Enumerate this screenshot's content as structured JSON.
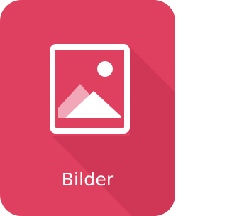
{
  "tile": {
    "label": "Bilder",
    "icon": "image-icon",
    "colors": {
      "background": "#e0405f",
      "shadow": "#c2304f",
      "icon": "#ffffff",
      "icon_mountain_back": "#f2a7b8"
    }
  }
}
